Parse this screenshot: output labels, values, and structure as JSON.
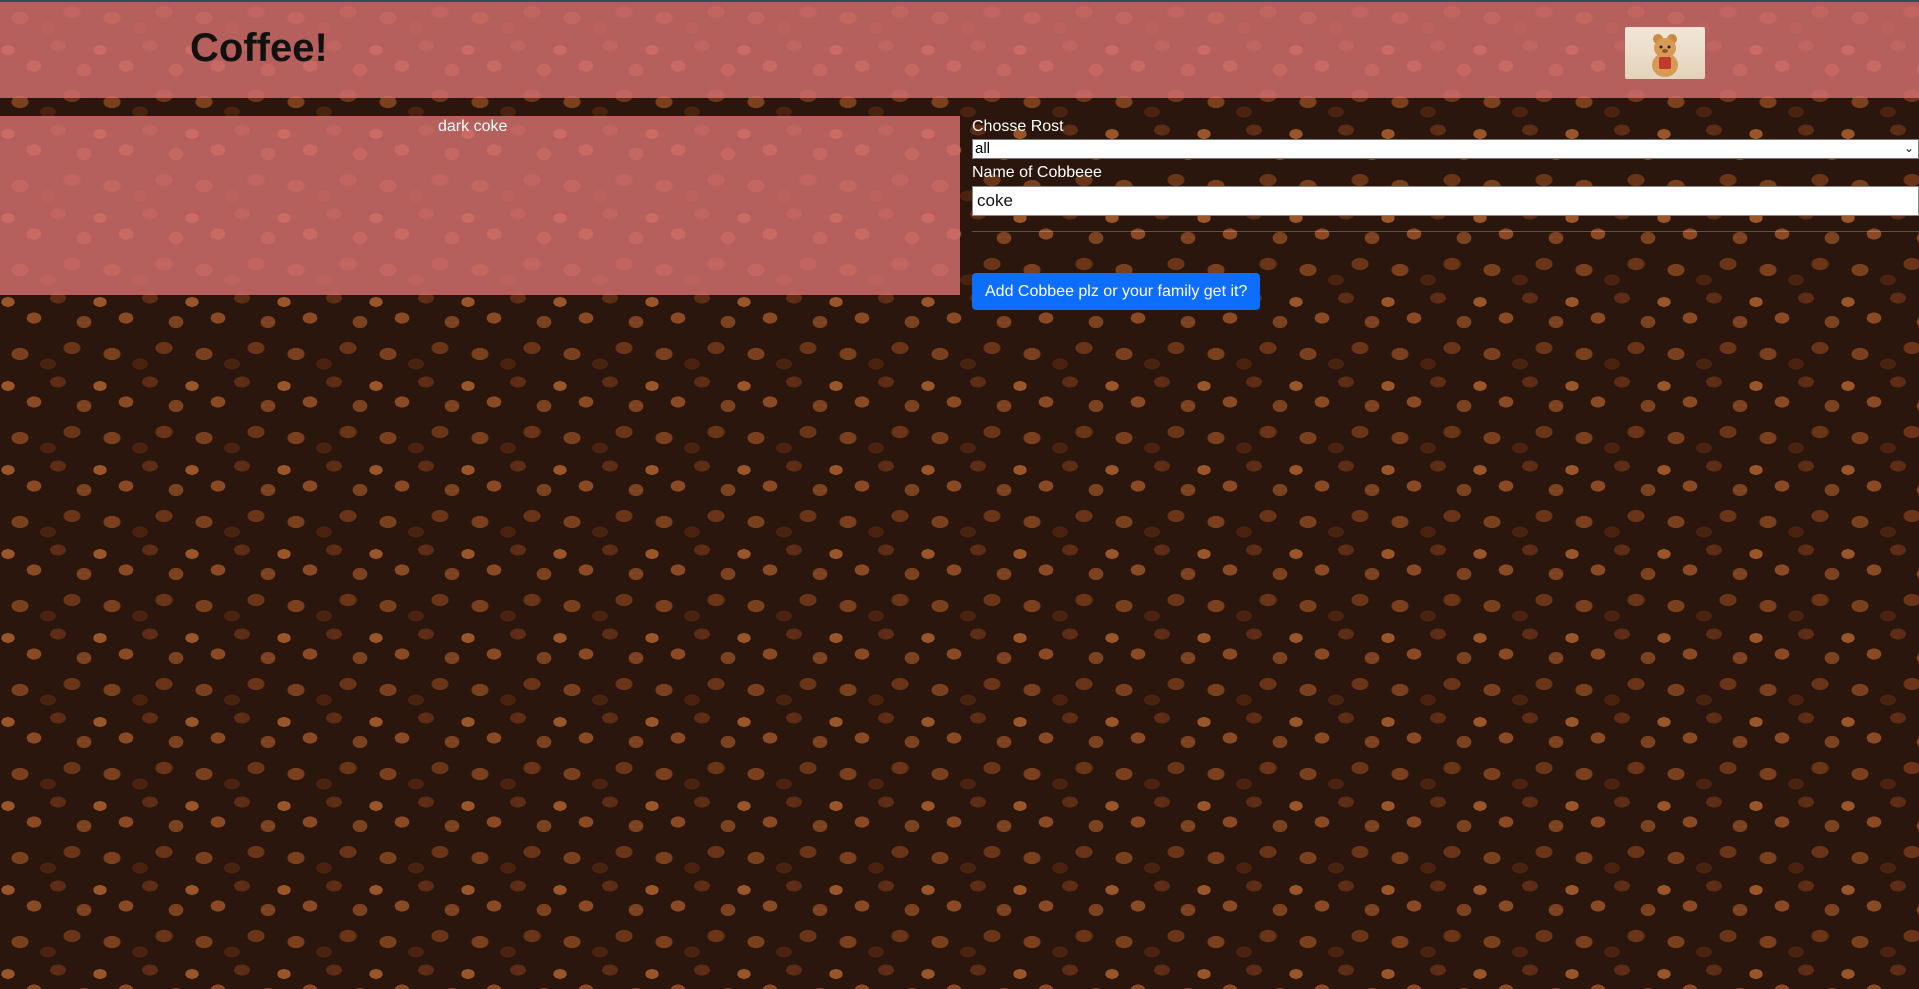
{
  "header": {
    "title": "Coffee!",
    "logo_icon": "bear-mascot-icon"
  },
  "coffee_list": {
    "items": [
      {
        "name": "dark coke"
      }
    ]
  },
  "form": {
    "roast_label": "Chosse Rost",
    "roast_selected": "all",
    "name_label": "Name of Cobbeee",
    "name_value": "coke",
    "submit_label": "Add Cobbee plz or your family get it?"
  },
  "colors": {
    "panel_overlay": "#d67070",
    "button": "#0d6efd",
    "background": "#2a160c"
  }
}
